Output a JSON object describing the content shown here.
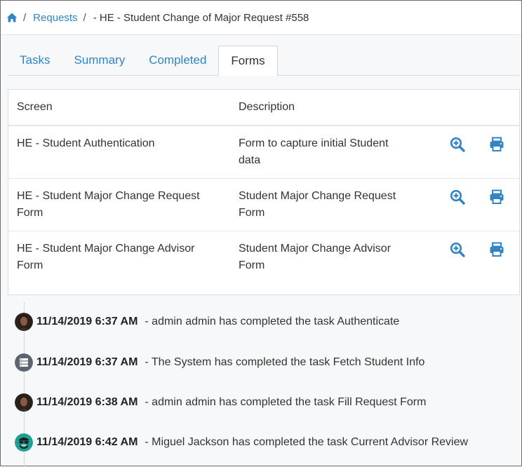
{
  "breadcrumb": {
    "home_icon": "home-icon",
    "separator": "/",
    "requests_label": "Requests",
    "current_label": "- HE - Student Change of Major Request #558"
  },
  "tabs": [
    {
      "label": "Tasks",
      "active": false
    },
    {
      "label": "Summary",
      "active": false
    },
    {
      "label": "Completed",
      "active": false
    },
    {
      "label": "Forms",
      "active": true
    }
  ],
  "forms_table": {
    "headers": {
      "screen": "Screen",
      "description": "Description"
    },
    "rows": [
      {
        "screen_line1": "HE - Student Authentication",
        "screen_line2": "",
        "desc_line1": "Form to capture initial Student",
        "desc_line2": "data"
      },
      {
        "screen_line1": "HE - Student Major Change Request",
        "screen_line2": "Form",
        "desc_line1": "Student Major Change Request",
        "desc_line2": "Form"
      },
      {
        "screen_line1": "HE - Student Major Change Advisor",
        "screen_line2": "Form",
        "desc_line1": "Student Major Change Advisor",
        "desc_line2": "Form"
      }
    ],
    "row_actions": [
      "zoom-in-icon",
      "print-icon"
    ]
  },
  "timeline": [
    {
      "avatar": "user-photo-avatar",
      "time": "11/14/2019 6:37 AM",
      "text": "- admin admin has completed the task Authenticate"
    },
    {
      "avatar": "system-server-icon",
      "time": "11/14/2019 6:37 AM",
      "text": "- The System has completed the task Fetch Student Info"
    },
    {
      "avatar": "user-photo-avatar",
      "time": "11/14/2019 6:38 AM",
      "text": "- admin admin has completed the task Fill Request Form"
    },
    {
      "avatar": "teal-glasses-avatar",
      "time": "11/14/2019 6:42 AM",
      "text": "- Miguel Jackson has completed the task Current Advisor Review"
    }
  ],
  "colors": {
    "link": "#3184c6",
    "teal_avatar": "#1f9e95",
    "system_avatar": "#5b6570"
  }
}
